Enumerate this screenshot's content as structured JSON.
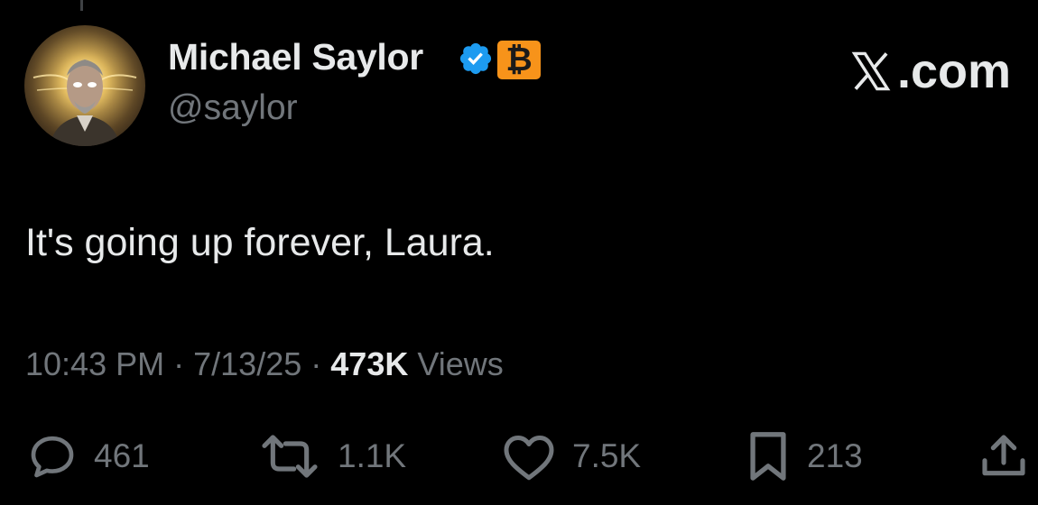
{
  "author": {
    "display_name": "Michael Saylor",
    "handle": "@saylor",
    "verified_icon": "verified-badge-icon",
    "affiliation_badge": "₿",
    "affiliation_color": "#f7931a",
    "verified_color": "#1d9bf0"
  },
  "brand": {
    "suffix": ".com",
    "icon": "x-logo-icon"
  },
  "tweet": {
    "text": "It's going up forever, Laura."
  },
  "meta": {
    "time": "10:43 PM",
    "separator": "·",
    "date": "7/13/25",
    "views_count": "473K",
    "views_label": "Views"
  },
  "actions": {
    "replies": {
      "icon": "reply-icon",
      "count": "461"
    },
    "reposts": {
      "icon": "repost-icon",
      "count": "1.1K"
    },
    "likes": {
      "icon": "heart-icon",
      "count": "7.5K"
    },
    "bookmarks": {
      "icon": "bookmark-icon",
      "count": "213"
    },
    "share": {
      "icon": "share-icon"
    }
  },
  "colors": {
    "background": "#000000",
    "text": "#e7e9ea",
    "muted": "#71767b"
  }
}
